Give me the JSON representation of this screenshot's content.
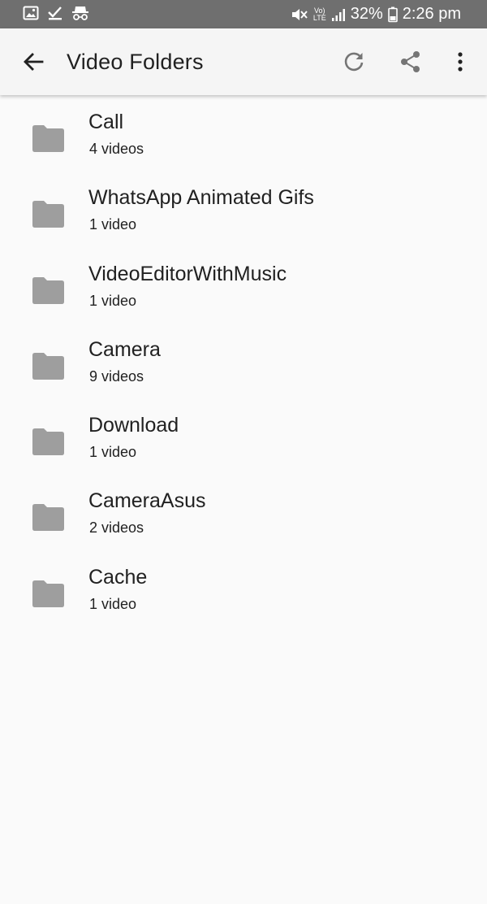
{
  "status_bar": {
    "battery": "32%",
    "time": "2:26 pm",
    "volte_label_top": "Vo)",
    "volte_label_bottom": "LTE",
    "icons": [
      "image-icon",
      "check-icon",
      "incognito-icon",
      "mute-icon",
      "volte-icon",
      "signal-icon",
      "battery-icon"
    ]
  },
  "toolbar": {
    "title": "Video Folders",
    "icons": [
      "back-arrow-icon",
      "refresh-icon",
      "share-icon",
      "more-vert-icon"
    ]
  },
  "colors": {
    "status_bar": "#6f6f6f",
    "toolbar": "#f5f5f5",
    "background": "#fafafa",
    "folder_icon": "#9e9e9e",
    "text": "#212121"
  },
  "folders": [
    {
      "name": "Call",
      "count": "4 videos"
    },
    {
      "name": "WhatsApp Animated Gifs",
      "count": "1 video"
    },
    {
      "name": "VideoEditorWithMusic",
      "count": "1 video"
    },
    {
      "name": "Camera",
      "count": "9 videos"
    },
    {
      "name": "Download",
      "count": "1 video"
    },
    {
      "name": "CameraAsus",
      "count": "2 videos"
    },
    {
      "name": "Cache",
      "count": "1 video"
    }
  ]
}
